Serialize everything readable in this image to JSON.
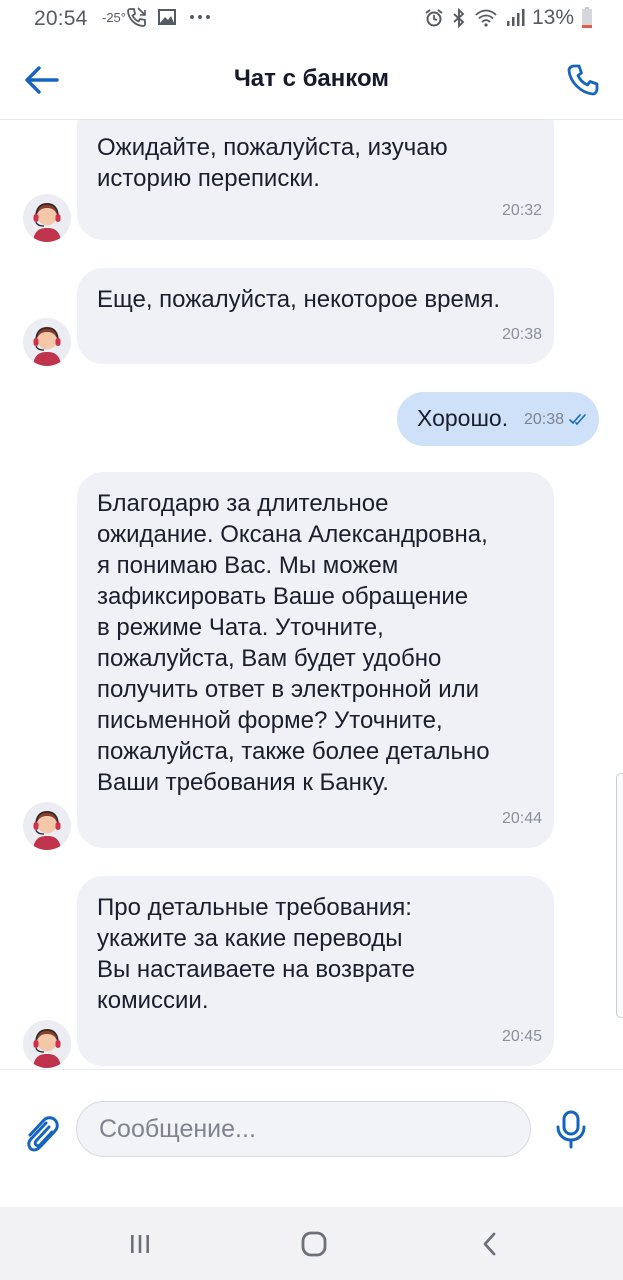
{
  "status_bar": {
    "time": "20:54",
    "temperature": "-25°",
    "battery_percent": "13%",
    "icons": [
      "call-missed-icon",
      "image-icon",
      "more-dots-icon",
      "alarm-icon",
      "bluetooth-icon",
      "wifi-icon",
      "signal-icon",
      "battery-icon"
    ]
  },
  "header": {
    "title": "Чат с банком",
    "back_icon": "arrow-left-icon",
    "call_icon": "phone-icon"
  },
  "messages": [
    {
      "direction": "incoming",
      "text": "Ожидайте, пожалуйста, изучаю\nисторию переписки.",
      "time": "20:32"
    },
    {
      "direction": "incoming",
      "text": "Еще, пожалуйста, некоторое время.",
      "time": "20:38"
    },
    {
      "direction": "outgoing",
      "text": "Хорошо.",
      "time": "20:38",
      "status": "read"
    },
    {
      "direction": "incoming",
      "text": "Благодарю за длительное\nожидание. Оксана Александровна,\nя понимаю Вас. Мы можем\nзафиксировать Ваше обращение\nв режиме Чата. Уточните,\nпожалуйста, Вам будет удобно\nполучить ответ в электронной или\nписьменной форме? Уточните,\nпожалуйста, также более детально\nВаши требования к Банку.",
      "time": "20:44"
    },
    {
      "direction": "incoming",
      "text": "Про детальные требования:\nукажите за какие переводы\nВы настаиваете на возврате\nкомиссии.",
      "time": "20:45"
    }
  ],
  "composer": {
    "placeholder": "Сообщение...",
    "value": "",
    "attach_icon": "paperclip-icon",
    "mic_icon": "microphone-icon"
  },
  "colors": {
    "accent": "#1565c0",
    "incoming_bubble": "#eff1f6",
    "outgoing_bubble": "#cfe1f8"
  }
}
